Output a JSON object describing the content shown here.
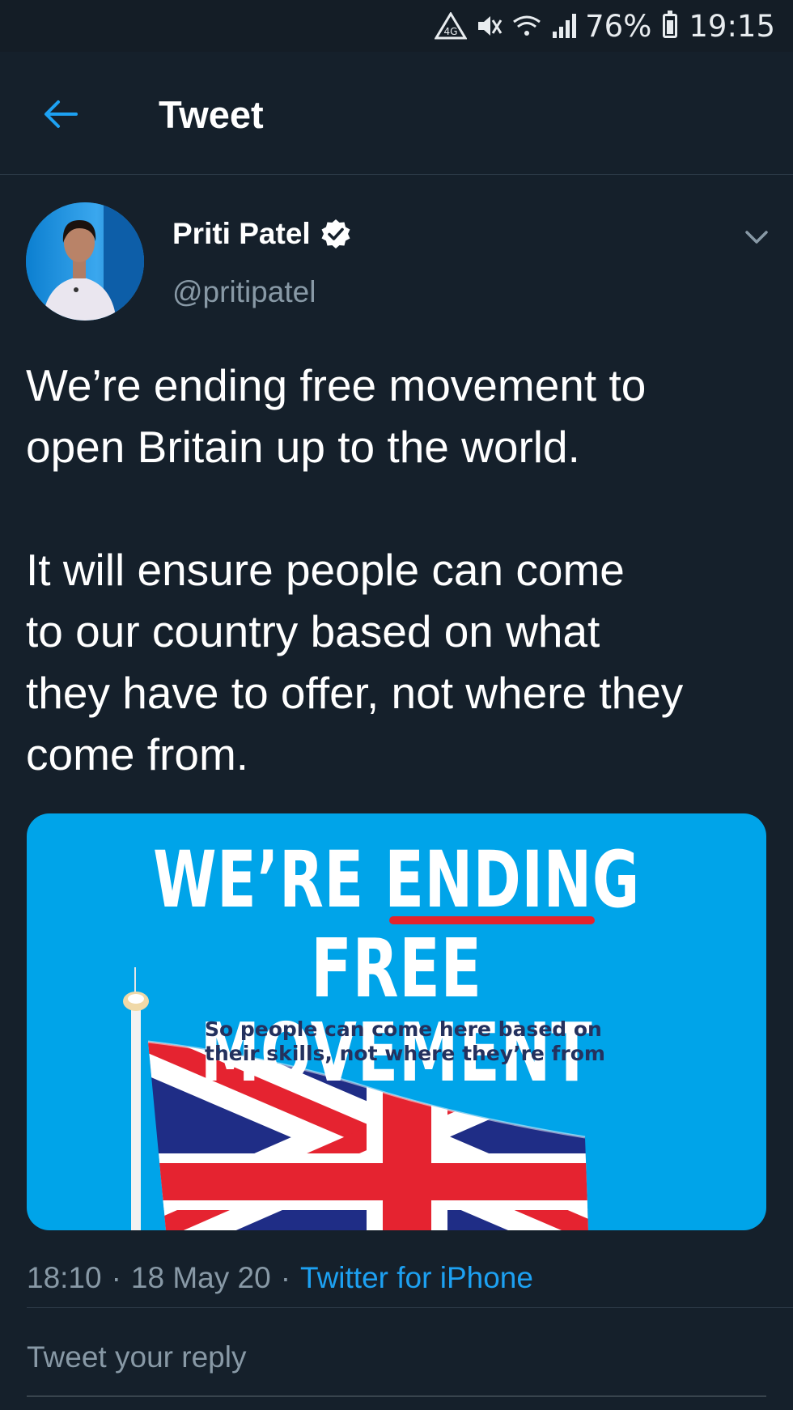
{
  "status_bar": {
    "battery_percent": "76%",
    "time": "19:15"
  },
  "header": {
    "title": "Tweet"
  },
  "tweet": {
    "author_name": "Priti Patel",
    "author_handle": "@pritipatel",
    "verified": true,
    "text": "We’re ending free movement to\nopen Britain up to the world.\n\nIt will ensure people can come\nto our country based on what\nthey have to offer, not where they\ncome from.",
    "media": {
      "headline_line1_part1": "WE’RE ",
      "headline_line1_part2": "ENDING",
      "headline_line2": "FREE MOVEMENT",
      "subline_1": "So people can come here based on",
      "subline_2": "their skills, not where they’re from"
    },
    "time": "18:10",
    "date": "18 May 20",
    "source": "Twitter for iPhone"
  },
  "reply": {
    "placeholder": "Tweet your reply"
  },
  "colors": {
    "background": "#15202b",
    "accent": "#1da1f2",
    "muted": "#8899a6",
    "media_blue": "#00a4e9"
  }
}
